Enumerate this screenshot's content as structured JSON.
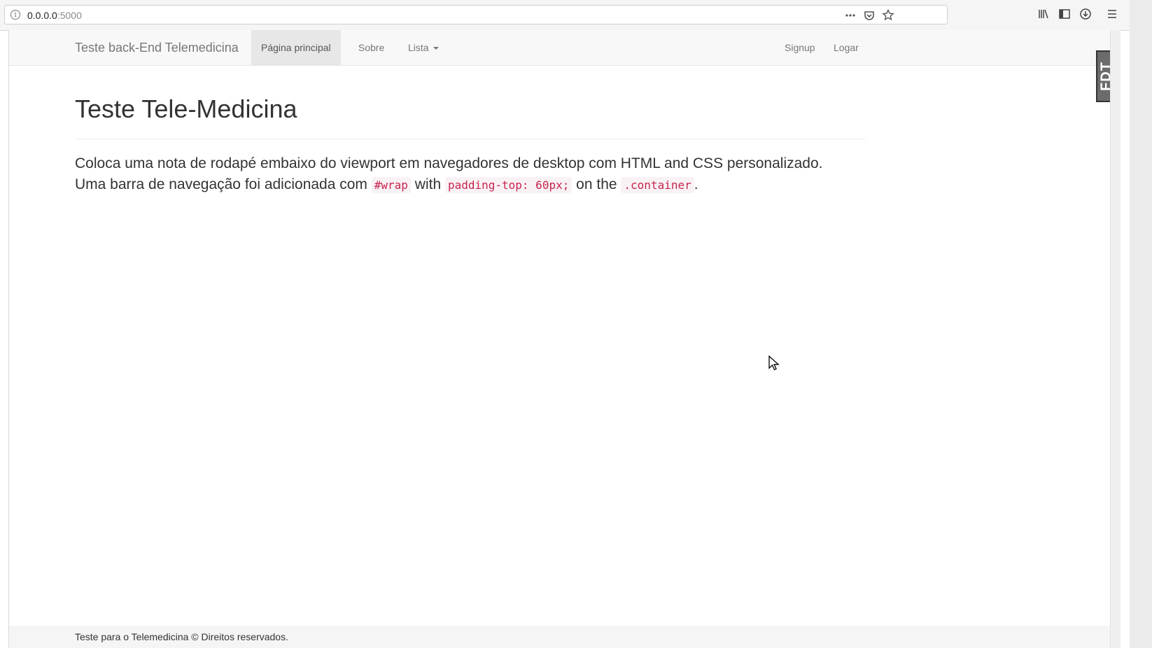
{
  "browser": {
    "url_host": "0.0.0.0",
    "url_port": ":5000",
    "icons": {
      "info": "info-icon",
      "more": "ellipsis-icon",
      "pocket": "pocket-icon",
      "bookmark": "star-icon",
      "library": "library-icon",
      "sidebar": "sidebar-icon",
      "downloads": "download-icon",
      "menu": "hamburger-menu-icon"
    }
  },
  "navbar": {
    "brand": "Teste back-End Telemedicina",
    "links": [
      {
        "label": "Página principal",
        "active": true
      },
      {
        "label": "Sobre"
      },
      {
        "label": "Lista"
      }
    ],
    "right_links": [
      {
        "label": "Signup"
      },
      {
        "label": "Logar"
      }
    ]
  },
  "main": {
    "title": "Teste Tele-Medicina",
    "lead_line1": "Coloca uma nota de rodapé embaixo do viewport em navegadores de desktop com HTML and CSS personalizado.",
    "lead_line2_prefix": "Uma barra de navegação foi adicionada com ",
    "code1": "#wrap",
    "text_with": " with ",
    "code2": "padding-top: 60px;",
    "text_onthe": " on the ",
    "code3": ".container",
    "text_end": "."
  },
  "footer": {
    "text": "Teste para o Telemedicina © Direitos reservados."
  },
  "badge": {
    "text": "FDT"
  },
  "colors": {
    "navbar_bg": "#f8f8f8",
    "active_link_bg": "#e7e7e7",
    "code_color": "#c7254e",
    "code_bg": "#f9f2f4",
    "footer_bg": "#f5f5f5"
  }
}
